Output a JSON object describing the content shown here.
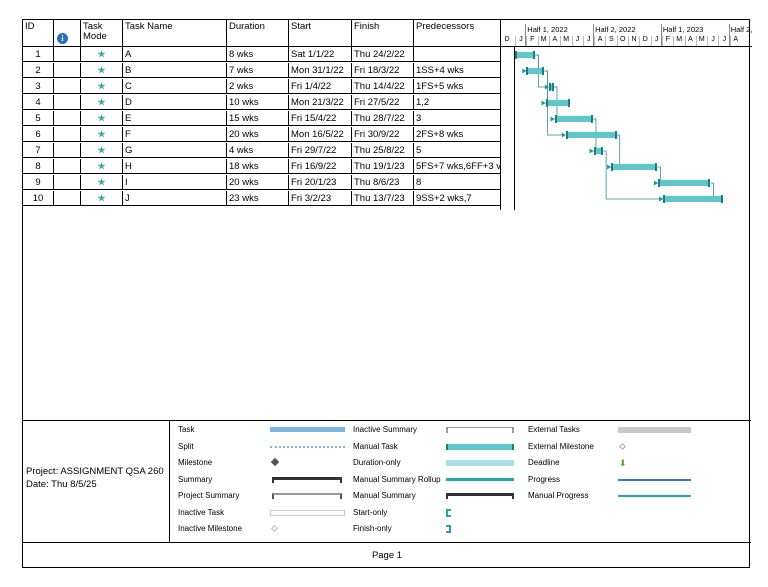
{
  "table": {
    "headers": {
      "id": "ID",
      "info": "",
      "mode": "Task Mode",
      "name": "Task Name",
      "duration": "Duration",
      "start": "Start",
      "finish": "Finish",
      "pred": "Predecessors"
    },
    "rows": [
      {
        "id": "1",
        "name": "A",
        "duration": "8 wks",
        "start": "Sat 1/1/22",
        "finish": "Thu 24/2/22",
        "pred": ""
      },
      {
        "id": "2",
        "name": "B",
        "duration": "7 wks",
        "start": "Mon 31/1/22",
        "finish": "Fri 18/3/22",
        "pred": "1SS+4 wks"
      },
      {
        "id": "3",
        "name": "C",
        "duration": "2 wks",
        "start": "Fri 1/4/22",
        "finish": "Thu 14/4/22",
        "pred": "1FS+5 wks"
      },
      {
        "id": "4",
        "name": "D",
        "duration": "10 wks",
        "start": "Mon 21/3/22",
        "finish": "Fri 27/5/22",
        "pred": "1,2"
      },
      {
        "id": "5",
        "name": "E",
        "duration": "15 wks",
        "start": "Fri 15/4/22",
        "finish": "Thu 28/7/22",
        "pred": "3"
      },
      {
        "id": "6",
        "name": "F",
        "duration": "20 wks",
        "start": "Mon 16/5/22",
        "finish": "Fri 30/9/22",
        "pred": "2FS+8 wks"
      },
      {
        "id": "7",
        "name": "G",
        "duration": "4 wks",
        "start": "Fri 29/7/22",
        "finish": "Thu 25/8/22",
        "pred": "5"
      },
      {
        "id": "8",
        "name": "H",
        "duration": "18 wks",
        "start": "Fri 16/9/22",
        "finish": "Thu 19/1/23",
        "pred": "5FS+7 wks,6FF+3 v"
      },
      {
        "id": "9",
        "name": "I",
        "duration": "20 wks",
        "start": "Fri 20/1/23",
        "finish": "Thu 8/6/23",
        "pred": "8"
      },
      {
        "id": "10",
        "name": "J",
        "duration": "23 wks",
        "start": "Fri 3/2/23",
        "finish": "Thu 13/7/23",
        "pred": "9SS+2 wks,7"
      }
    ]
  },
  "timescale": {
    "halves": [
      "Half 1, 2022",
      "Half 2, 2022",
      "Half 1, 2023",
      "Half 2,"
    ],
    "months": [
      "D",
      "J",
      "F",
      "M",
      "A",
      "M",
      "J",
      "J",
      "A",
      "S",
      "O",
      "N",
      "D",
      "J",
      "F",
      "M",
      "A",
      "M",
      "J",
      "J",
      "A"
    ]
  },
  "gantt_bars": [
    {
      "task": "A",
      "start_month": 1.0,
      "end_month": 2.8
    },
    {
      "task": "B",
      "start_month": 2.0,
      "end_month": 3.6
    },
    {
      "task": "C",
      "start_month": 4.0,
      "end_month": 4.45
    },
    {
      "task": "D",
      "start_month": 3.7,
      "end_month": 5.9
    },
    {
      "task": "E",
      "start_month": 4.5,
      "end_month": 7.9
    },
    {
      "task": "F",
      "start_month": 5.5,
      "end_month": 10.0
    },
    {
      "task": "G",
      "start_month": 7.95,
      "end_month": 8.8
    },
    {
      "task": "H",
      "start_month": 9.5,
      "end_month": 13.6
    },
    {
      "task": "I",
      "start_month": 13.65,
      "end_month": 18.3
    },
    {
      "task": "J",
      "start_month": 14.1,
      "end_month": 19.4
    }
  ],
  "legend": {
    "project": "Project: ASSIGNMENT QSA 260",
    "date": "Date: Thu 8/5/25",
    "col1": [
      "Task",
      "Split",
      "Milestone",
      "Summary",
      "Project Summary",
      "Inactive Task",
      "Inactive Milestone"
    ],
    "col2": [
      "Inactive Summary",
      "Manual Task",
      "Duration-only",
      "Manual Summary Rollup",
      "Manual Summary",
      "Start-only",
      "Finish-only"
    ],
    "col3": [
      "External Tasks",
      "External Milestone",
      "Deadline",
      "Progress",
      "Manual Progress"
    ],
    "colors": {
      "task_bar": "#5fc6cc",
      "task_blue": "#7fb3e0",
      "progress": "#2f7cc9",
      "deadline": "#5aa02c"
    }
  },
  "footer": {
    "page": "Page 1"
  }
}
